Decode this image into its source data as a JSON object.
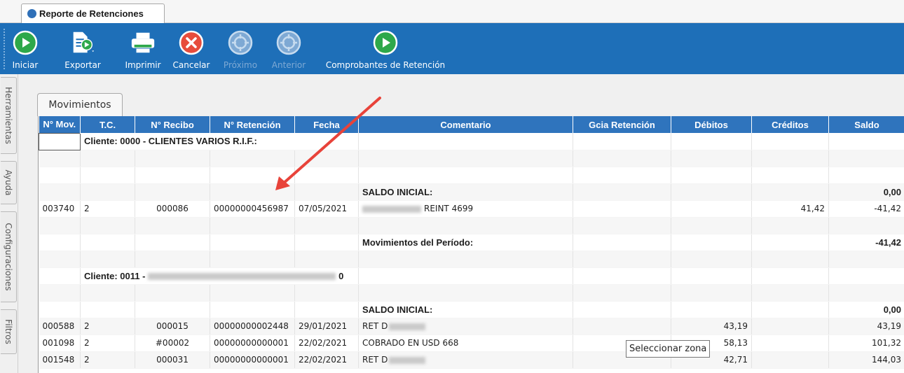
{
  "window": {
    "tab_title": "Reporte de Retenciones"
  },
  "toolbar": {
    "buttons": [
      {
        "label": "Iniciar",
        "icon": "play-icon",
        "enabled": true
      },
      {
        "label": "Exportar",
        "icon": "export-icon",
        "enabled": true
      },
      {
        "label": "Imprimir",
        "icon": "printer-icon",
        "enabled": true
      },
      {
        "label": "Cancelar",
        "icon": "cancel-icon",
        "enabled": true
      },
      {
        "label": "Próximo",
        "icon": "next-icon",
        "enabled": false
      },
      {
        "label": "Anterior",
        "icon": "previous-icon",
        "enabled": false
      },
      {
        "label": "Comprobantes de Retención",
        "icon": "play-icon",
        "enabled": true
      }
    ]
  },
  "sidebar": {
    "tabs": [
      "Herramientas",
      "Ayuda",
      "Configuraciones",
      "Filtros"
    ]
  },
  "panel": {
    "tab_label": "Movimientos"
  },
  "grid": {
    "columns": [
      "N° Mov.",
      "T.C.",
      "N° Recibo",
      "N° Retención",
      "Fecha",
      "Comentario",
      "Gcia Retención",
      "Débitos",
      "Créditos",
      "Saldo"
    ],
    "rows": [
      {
        "kind": "client",
        "text": "Cliente: 0000 - CLIENTES VARIOS R.I.F.:"
      },
      {
        "kind": "blank"
      },
      {
        "kind": "blank"
      },
      {
        "kind": "summary",
        "label": "SALDO INICIAL:",
        "saldo": "0,00"
      },
      {
        "kind": "data",
        "mov": "003740",
        "tc": "2",
        "recibo": "000086",
        "retencion": "00000000456987",
        "fecha": "07/05/2021",
        "comentario": "REINT 4699",
        "gcia": "",
        "debitos": "",
        "creditos": "41,42",
        "saldo": "-41,42"
      },
      {
        "kind": "blank"
      },
      {
        "kind": "summary",
        "label": "Movimientos del Período:",
        "saldo": "-41,42"
      },
      {
        "kind": "blank"
      },
      {
        "kind": "client",
        "text": "Cliente: 0011 -",
        "suffix": "0"
      },
      {
        "kind": "blank"
      },
      {
        "kind": "summary",
        "label": "SALDO INICIAL:",
        "saldo": "0,00"
      },
      {
        "kind": "data",
        "mov": "000588",
        "tc": "2",
        "recibo": "000015",
        "retencion": "00000000002448",
        "fecha": "29/01/2021",
        "comentario": "RET D",
        "gcia": "",
        "debitos": "43,19",
        "creditos": "",
        "saldo": "43,19"
      },
      {
        "kind": "data",
        "mov": "001098",
        "tc": "2",
        "recibo": "#00002",
        "retencion": "00000000000001",
        "fecha": "22/02/2021",
        "comentario": "COBRADO EN USD 668",
        "gcia": "",
        "debitos": "58,13",
        "creditos": "",
        "saldo": "101,32"
      },
      {
        "kind": "data",
        "mov": "001548",
        "tc": "2",
        "recibo": "000031",
        "retencion": "00000000000001",
        "fecha": "22/02/2021",
        "comentario": "RET D",
        "gcia": "",
        "debitos": "42,71",
        "creditos": "",
        "saldo": "144,03"
      }
    ]
  },
  "tooltip": {
    "text": "Seleccionar zona"
  },
  "colors": {
    "toolbar_blue": "#1e6fb8",
    "header_blue": "#2f74bd",
    "play_green": "#2ea84a",
    "cancel_red": "#e74c3c",
    "arrow_red": "#e8433a"
  }
}
